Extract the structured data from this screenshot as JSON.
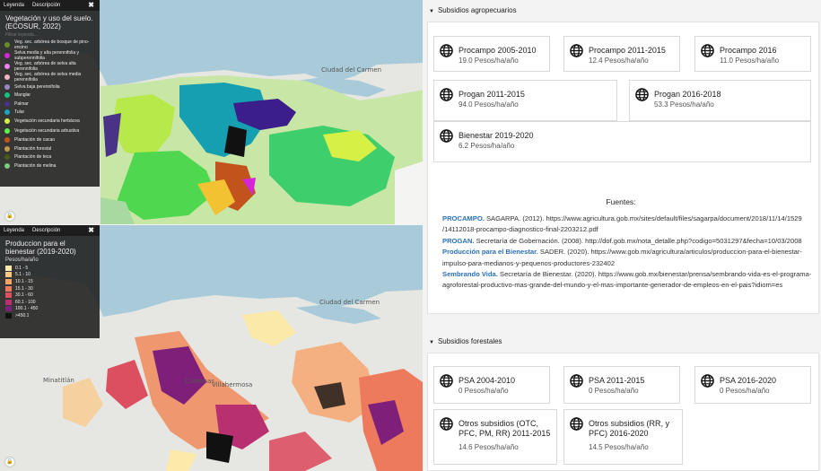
{
  "legend1": {
    "tab_leyenda": "Leyenda",
    "tab_descripcion": "Descripción",
    "title": "Vegetación y uso del suelo. (ECOSUR, 2022)",
    "filter": "Filtrar leyenda...",
    "items": [
      {
        "label": "Veg. sec. arbórea de bosque de pino-encino",
        "color": "#6a8e23"
      },
      {
        "label": "Selva media y alta perennifolia y subperennifolia",
        "color": "#d526d5"
      },
      {
        "label": "Veg. sec. arbórea de selva alta perennifolia",
        "color": "#ee82ee"
      },
      {
        "label": "Veg. sec. arbórea de selva media perennifolia",
        "color": "#f4b6c2"
      },
      {
        "label": "Selva baja perennifolia",
        "color": "#9a86c4"
      },
      {
        "label": "Manglar",
        "color": "#13c27e"
      },
      {
        "label": "Palmar",
        "color": "#4a3287"
      },
      {
        "label": "Tular",
        "color": "#1aa3c4"
      },
      {
        "label": "Vegetación secundaria herbácea",
        "color": "#d6f046"
      },
      {
        "label": "Vegetación secundaria arbustiva",
        "color": "#5cf04a"
      },
      {
        "label": "Plantación de cacao",
        "color": "#c2531c"
      },
      {
        "label": "Plantación forestal",
        "color": "#c29a4a"
      },
      {
        "label": "Plantación de teca",
        "color": "#4a5a1a"
      },
      {
        "label": "Plantación de melina",
        "color": "#7acc7a"
      }
    ]
  },
  "legend2": {
    "tab_leyenda": "Leyenda",
    "tab_descripcion": "Descripción",
    "title": "Produccion para el bienestar (2019-2020)",
    "unit": "Pesos/ha/año",
    "items": [
      {
        "label": "0.1 - 5",
        "color": "#fde9a9"
      },
      {
        "label": "5.1 - 10",
        "color": "#fbc783"
      },
      {
        "label": "10.1 - 15",
        "color": "#f7a367"
      },
      {
        "label": "15.1 - 30",
        "color": "#ee7a5d"
      },
      {
        "label": "30.1 - 60",
        "color": "#dc4f61"
      },
      {
        "label": "60.1 - 100",
        "color": "#b8306f"
      },
      {
        "label": "100.1 - 450",
        "color": "#7e1f7a"
      },
      {
        "label": ">450.1",
        "color": "#111111"
      }
    ]
  },
  "map1": {
    "city": "Ciudad del Carmen"
  },
  "map2": {
    "city1": "Ciudad del Carmen",
    "city2": "Minatitlán",
    "city3": "Cárdenas",
    "city4": "Villahermosa"
  },
  "agro": {
    "header": "Subsidios agropecuarios",
    "cards": [
      {
        "title": "Procampo 2005-2010",
        "value": "19.0 Pesos/ha/año"
      },
      {
        "title": "Procampo 2011-2015",
        "value": "12.4 Pesos/ha/año"
      },
      {
        "title": "Procampo 2016",
        "value": "11.0 Pesos/ha/año"
      },
      {
        "title": "Progan 2011-2015",
        "value": "94.0 Pesos/ha/año"
      },
      {
        "title": "Progan 2016-2018",
        "value": "53.3 Pesos/ha/año"
      },
      {
        "title": "Bienestar 2019-2020",
        "value": "6.2 Pesos/ha/año"
      }
    ],
    "fuentes_title": "Fuentes:",
    "refs": [
      {
        "name": "PROCAMPO.",
        "text": " SAGARPA. (2012). https://www.agricultura.gob.mx/sites/default/files/sagarpa/document/2018/11/14/1529 /14112018-procampo-diagnostico-final-2203212.pdf"
      },
      {
        "name": "PROGAN.",
        "text": " Secretaría de Gobernación. (2008). http://dof.gob.mx/nota_detalle.php?codigo=5031297&fecha=10/03/2008"
      },
      {
        "name": "Producción para el Bienestar.",
        "text": " SADER. (2020). https://www.gob.mx/agricultura/articulos/produccion-para-el-bienestar-impulso-para-medianos-y-pequenos-productores-232402"
      },
      {
        "name": "Sembrando Vida.",
        "text": " Secretaría de Bienestar. (2020). https://www.gob.mx/bienestar/prensa/sembrando-vida-es-el-programa-agroforestal-productivo-mas-grande-del-mundo-y-el-mas-importante-generador-de-empleos-en-el-pais?idiom=es"
      }
    ]
  },
  "forest": {
    "header": "Subsidios forestales",
    "cards": [
      {
        "title": "PSA 2004-2010",
        "value": "0 Pesos/ha/año"
      },
      {
        "title": "PSA 2011-2015",
        "value": "0 Pesos/ha/año"
      },
      {
        "title": "PSA 2016-2020",
        "value": "0 Pesos/ha/año"
      },
      {
        "title": "Otros subsidios (OTC, PFC, PM, RR) 2011-2015",
        "value": "14.6 Pesos/ha/año"
      },
      {
        "title": "Otros subsidios (RR, y PFC) 2016-2020",
        "value": "14.5 Pesos/ha/año"
      }
    ]
  },
  "colors": {
    "water": "#a9cbd9",
    "land": "#e8e8e4",
    "link": "#2a6fb8"
  }
}
